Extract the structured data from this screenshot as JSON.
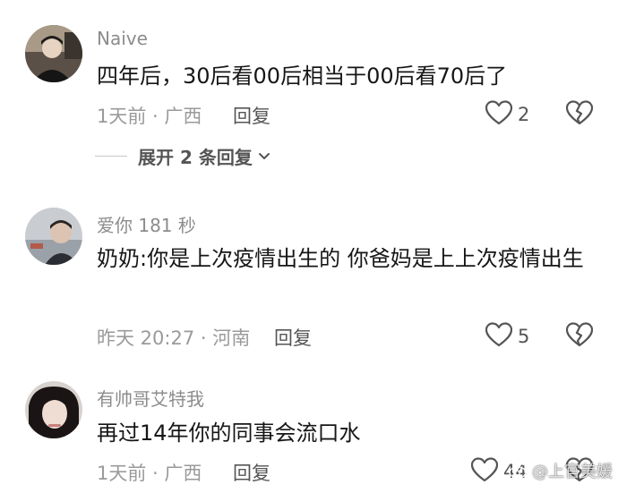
{
  "comments": [
    {
      "username": "Naive",
      "text": "四年后，30后看00后相当于00后看70后了",
      "time_location": "1天前 · 广西",
      "reply_label": "回复",
      "like_count": "2",
      "expand_label": "展开 2 条回复"
    },
    {
      "username": "爱你 181 秒",
      "text": "奶奶:你是上次疫情出生的 你爸妈是上上次疫情出生",
      "time_location": "昨天 20:27 · 河南",
      "reply_label": "回复",
      "like_count": "5"
    },
    {
      "username": "有帅哥艾特我",
      "text": "再过14年你的同事会流口水",
      "time_location": "1天前 · 广西",
      "reply_label": "回复",
      "like_count": "44"
    }
  ],
  "watermark": {
    "text": "@上官美媛",
    "icon": "weibo-logo"
  },
  "colors": {
    "text_primary": "#161616",
    "text_secondary": "#9a9a9a",
    "username": "#8c8c8c",
    "icon": "#555555"
  }
}
